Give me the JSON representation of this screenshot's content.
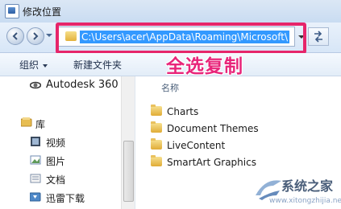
{
  "window": {
    "title": "修改位置"
  },
  "address": {
    "path": "C:\\Users\\acer\\AppData\\Roaming\\Microsoft\\"
  },
  "toolbar": {
    "organize": "组织",
    "new_folder": "新建文件夹"
  },
  "annotation": {
    "text": "全选复制"
  },
  "nav": {
    "items": [
      {
        "label": "Autodesk 360",
        "icon": "autodesk-icon"
      },
      {
        "label": "库",
        "icon": "library-icon"
      },
      {
        "label": "视频",
        "icon": "video-icon"
      },
      {
        "label": "图片",
        "icon": "picture-icon"
      },
      {
        "label": "文档",
        "icon": "document-icon"
      },
      {
        "label": "迅雷下载",
        "icon": "download-icon"
      }
    ]
  },
  "files": {
    "column_name": "名称",
    "items": [
      {
        "name": "Charts"
      },
      {
        "name": "Document Themes"
      },
      {
        "name": "LiveContent"
      },
      {
        "name": "SmartArt Graphics"
      }
    ]
  },
  "watermark": {
    "text": "系统之家",
    "url": "www.xitongzhijia.net"
  },
  "colors": {
    "highlight": "#3399ff",
    "annotation": "#e8257a",
    "frame": "#e6256a"
  }
}
